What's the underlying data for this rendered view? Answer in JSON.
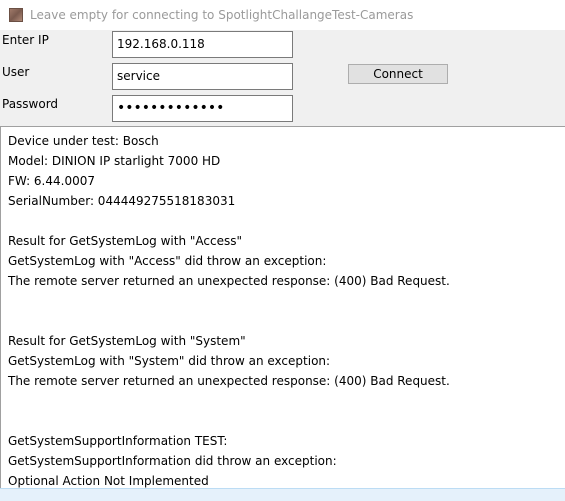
{
  "window": {
    "title": "Leave empty for connecting to SpotlightChallangeTest-Cameras"
  },
  "form": {
    "ip_label": "Enter IP",
    "ip_value": "192.168.0.118",
    "user_label": "User",
    "user_value": "service",
    "password_label": "Password",
    "password_masked": "•••••••••••••",
    "connect_label": "Connect"
  },
  "output": {
    "lines": [
      "Device under test: Bosch",
      "Model: DINION IP starlight 7000 HD",
      "FW: 6.44.0007",
      "SerialNumber: 044449275518183031",
      "",
      "Result for GetSystemLog with \"Access\"",
      "GetSystemLog with \"Access\" did throw an exception:",
      "The remote server returned an unexpected response: (400) Bad Request.",
      "",
      "",
      "Result for GetSystemLog with \"System\"",
      "GetSystemLog with \"System\" did throw an exception:",
      "The remote server returned an unexpected response: (400) Bad Request.",
      "",
      "",
      "GetSystemSupportInformation TEST:",
      "GetSystemSupportInformation did throw an exception:",
      "Optional Action Not Implemented"
    ]
  },
  "icons": {
    "app_icon": "app-icon"
  }
}
